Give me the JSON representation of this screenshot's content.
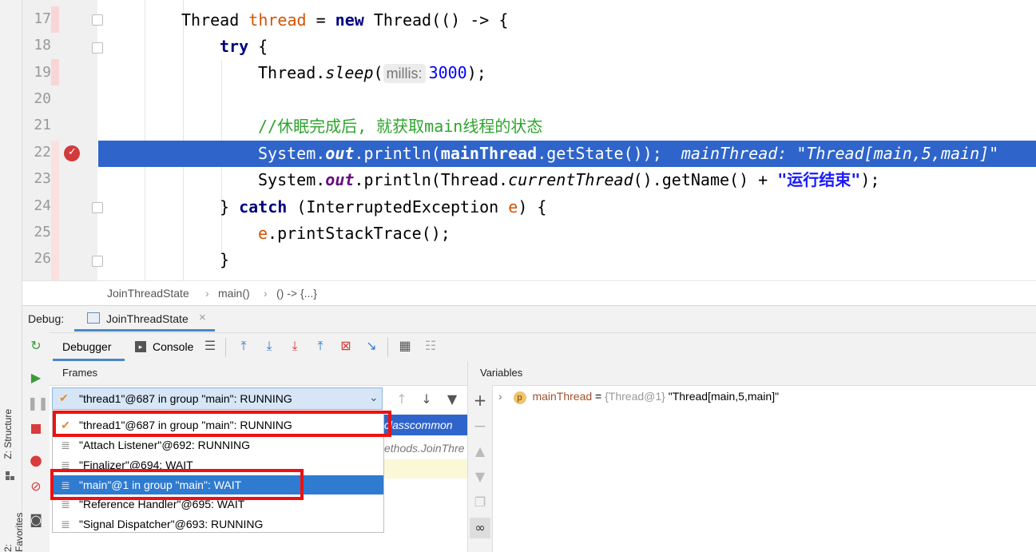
{
  "side_labels": {
    "structure": "Z: Structure",
    "favorites": "2: Favorites"
  },
  "editor": {
    "lines": [
      {
        "num": "17"
      },
      {
        "num": "18"
      },
      {
        "num": "19"
      },
      {
        "num": "20"
      },
      {
        "num": "21"
      },
      {
        "num": "22"
      },
      {
        "num": "23"
      },
      {
        "num": "24"
      },
      {
        "num": "25"
      },
      {
        "num": "26"
      }
    ],
    "code": {
      "l17_a": "Thread ",
      "l17_b": "thread",
      "l17_c": " = ",
      "l17_d": "new",
      "l17_e": " Thread(() -> {",
      "l18_a": "try",
      "l18_b": " {",
      "l19_a": "Thread.",
      "l19_b": "sleep",
      "l19_c": "(",
      "l19_hint": "millis:",
      "l19_d": "3000",
      "l19_e": ");",
      "l21": "//休眠完成后, 就获取main线程的状态",
      "l22_a": "System.",
      "l22_b": "out",
      "l22_c": ".println(",
      "l22_d": "mainThread",
      "l22_e": ".getState());",
      "l22_inline": "mainThread: \"Thread[main,5,main]\"",
      "l23_a": "System.",
      "l23_b": "out",
      "l23_c": ".println(Thread.",
      "l23_d": "currentThread",
      "l23_e": "().getName() + ",
      "l23_f": "\"运行结束\"",
      "l23_g": ");",
      "l24_a": "} ",
      "l24_b": "catch",
      "l24_c": " (InterruptedException ",
      "l24_d": "e",
      "l24_e": ") {",
      "l25_a": "e",
      "l25_b": ".printStackTrace();",
      "l26": "}"
    }
  },
  "breadcrumb": {
    "items": [
      "JoinThreadState",
      "main()",
      "() -> {...}"
    ],
    "sep": "›"
  },
  "debug": {
    "label": "Debug:",
    "tab": "JoinThreadState",
    "tab_close": "×",
    "toolbar": {
      "debugger": "Debugger",
      "console": "Console"
    }
  },
  "frames": {
    "header": "Frames",
    "selected": "\"thread1\"@687 in group \"main\": RUNNING",
    "bg_frame_1": "classcommon",
    "bg_frame_2": "ethods.JoinThre",
    "threads": [
      {
        "label": "\"thread1\"@687 in group \"main\": RUNNING",
        "icon": "check-icon"
      },
      {
        "label": "\"Attach Listener\"@692: RUNNING",
        "icon": "thread-icon"
      },
      {
        "label": "\"Finalizer\"@694: WAIT",
        "icon": "thread-icon"
      },
      {
        "label": "\"main\"@1 in group \"main\": WAIT",
        "icon": "thread-icon"
      },
      {
        "label": "\"Reference Handler\"@695: WAIT",
        "icon": "thread-icon"
      },
      {
        "label": "\"Signal Dispatcher\"@693: RUNNING",
        "icon": "thread-icon"
      }
    ]
  },
  "variables": {
    "header": "Variables",
    "row": {
      "badge": "p",
      "name": "mainThread",
      "eq": " = ",
      "type": "{Thread@1}",
      "value": " \"Thread[main,5,main]\""
    }
  },
  "colors": {
    "highlight": "#2f65ca",
    "selected_item": "#2f7bd0",
    "annotation": "#ee1111"
  }
}
